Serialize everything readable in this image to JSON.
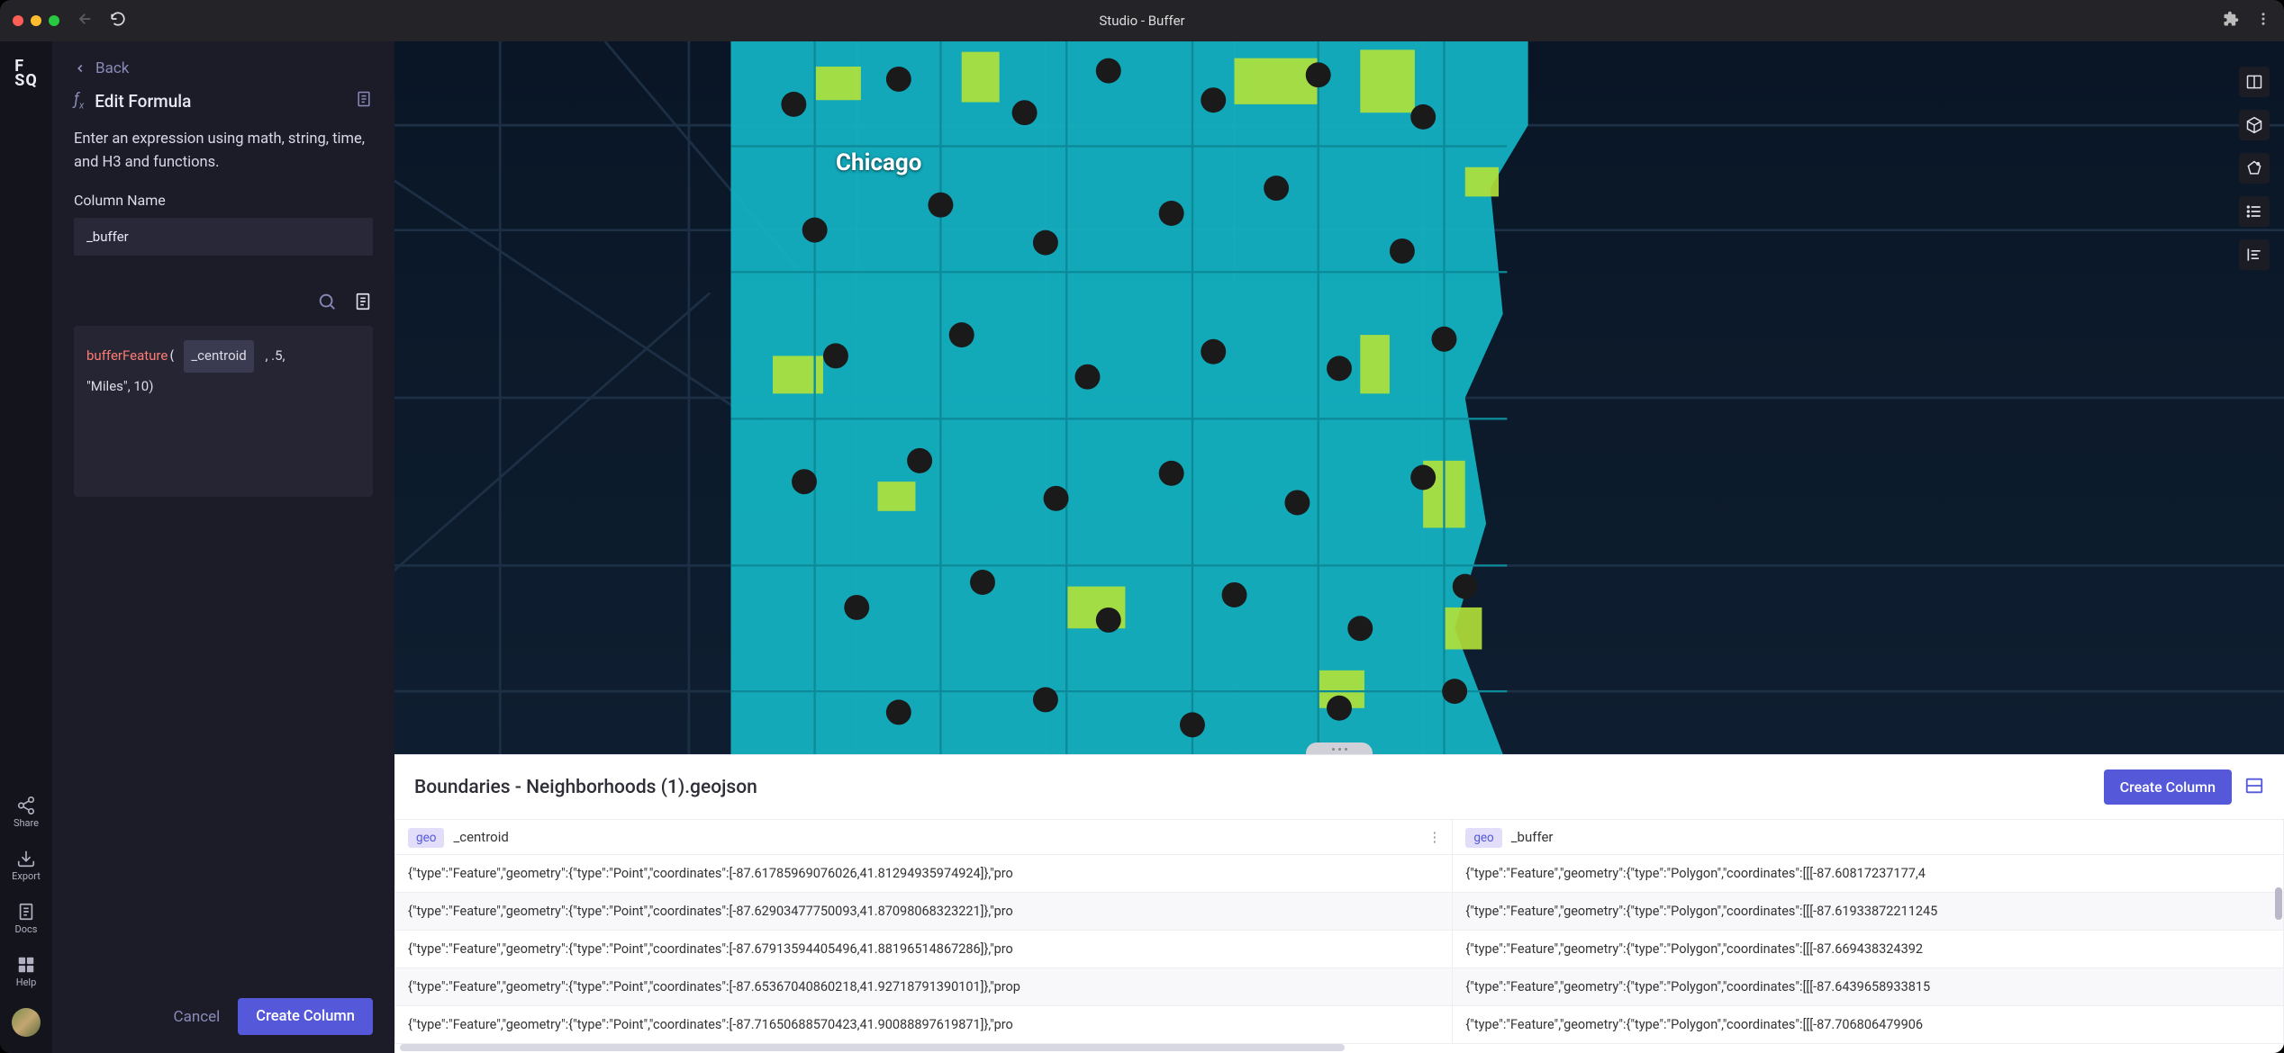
{
  "window": {
    "title": "Studio - Buffer"
  },
  "rail": {
    "logo_top": "F",
    "logo_bottom": "SQ",
    "items": [
      {
        "label": "Share"
      },
      {
        "label": "Export"
      },
      {
        "label": "Docs"
      },
      {
        "label": "Help"
      }
    ]
  },
  "panel": {
    "back": "Back",
    "heading": "Edit Formula",
    "description": "Enter an expression using math, string, time, and H3 and functions.",
    "column_name_label": "Column Name",
    "column_name_value": "_buffer",
    "formula": {
      "fn": "bufferFeature",
      "token": "_centroid",
      "rest1": " , .5,",
      "rest2": "\"Miles\", 10)"
    },
    "cancel": "Cancel",
    "create": "Create Column"
  },
  "map": {
    "city": "Chicago"
  },
  "table": {
    "title": "Boundaries - Neighborhoods (1).geojson",
    "create_btn": "Create Column",
    "columns": [
      {
        "tag": "geo",
        "name": "_centroid"
      },
      {
        "tag": "geo",
        "name": "_buffer"
      }
    ],
    "rows": [
      {
        "centroid": "{\"type\":\"Feature\",\"geometry\":{\"type\":\"Point\",\"coordinates\":[-87.61785969076026,41.81294935974924]},\"pro",
        "buffer": "{\"type\":\"Feature\",\"geometry\":{\"type\":\"Polygon\",\"coordinates\":[[[-87.60817237177,4"
      },
      {
        "centroid": "{\"type\":\"Feature\",\"geometry\":{\"type\":\"Point\",\"coordinates\":[-87.62903477750093,41.87098068323221]},\"pro",
        "buffer": "{\"type\":\"Feature\",\"geometry\":{\"type\":\"Polygon\",\"coordinates\":[[[-87.61933872211245"
      },
      {
        "centroid": "{\"type\":\"Feature\",\"geometry\":{\"type\":\"Point\",\"coordinates\":[-87.67913594405496,41.88196514867286]},\"pro",
        "buffer": "{\"type\":\"Feature\",\"geometry\":{\"type\":\"Polygon\",\"coordinates\":[[[-87.669438324392"
      },
      {
        "centroid": "{\"type\":\"Feature\",\"geometry\":{\"type\":\"Point\",\"coordinates\":[-87.65367040860218,41.92718791390101]},\"prop",
        "buffer": "{\"type\":\"Feature\",\"geometry\":{\"type\":\"Polygon\",\"coordinates\":[[[-87.6439658933815"
      },
      {
        "centroid": "{\"type\":\"Feature\",\"geometry\":{\"type\":\"Point\",\"coordinates\":[-87.71650688570423,41.90088897619871]},\"pro",
        "buffer": "{\"type\":\"Feature\",\"geometry\":{\"type\":\"Polygon\",\"coordinates\":[[[-87.706806479906"
      }
    ]
  }
}
